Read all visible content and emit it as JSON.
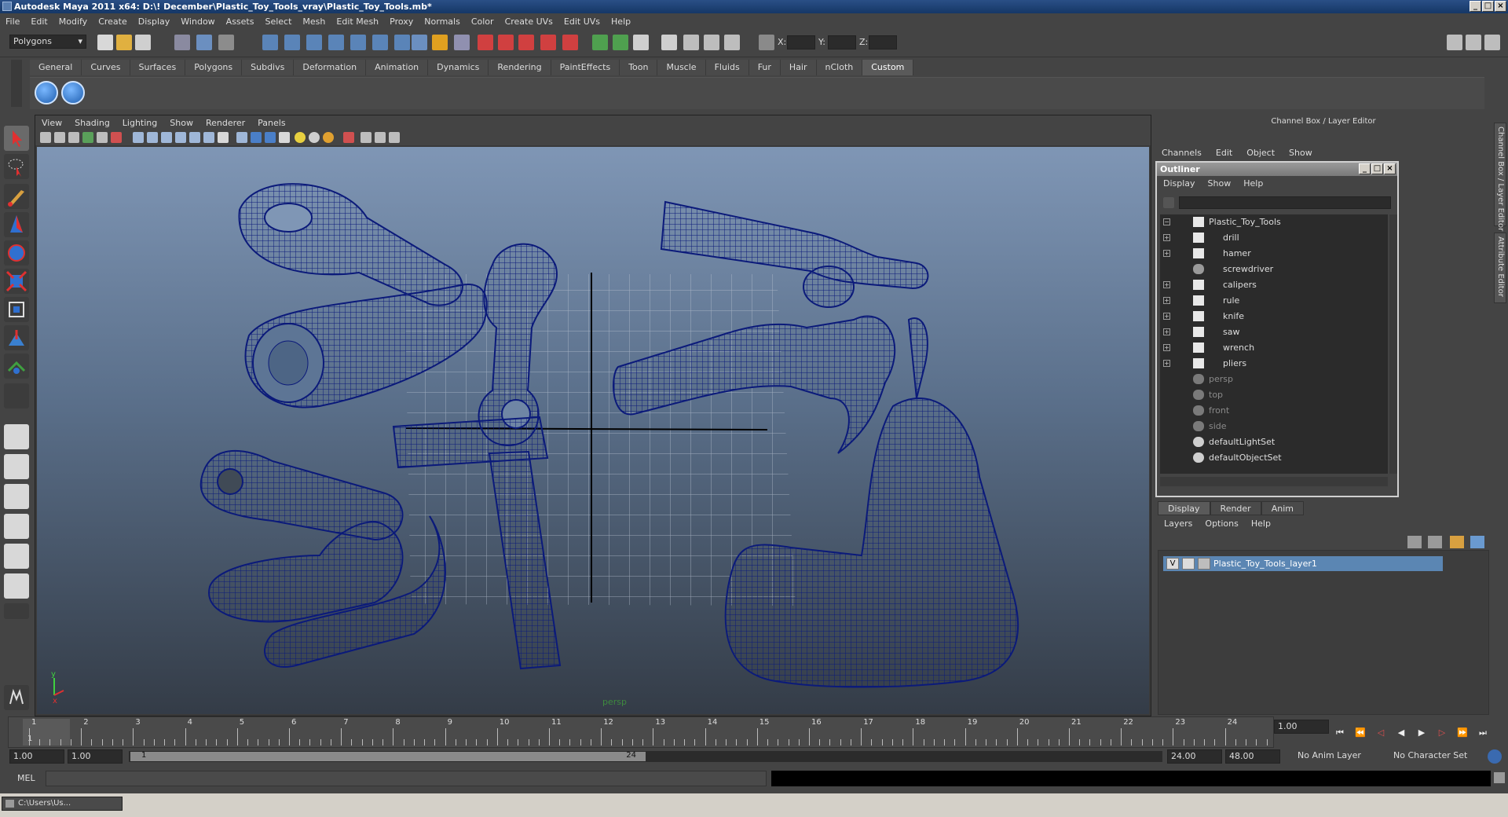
{
  "window": {
    "title": "Autodesk Maya 2011 x64: D:\\! December\\Plastic_Toy_Tools_vray\\Plastic_Toy_Tools.mb*"
  },
  "menubar": [
    "File",
    "Edit",
    "Modify",
    "Create",
    "Display",
    "Window",
    "Assets",
    "Select",
    "Mesh",
    "Edit Mesh",
    "Proxy",
    "Normals",
    "Color",
    "Create UVs",
    "Edit UVs",
    "Help"
  ],
  "statusline": {
    "menuset": "Polygons",
    "x_label": "X:",
    "y_label": "Y:",
    "z_label": "Z:"
  },
  "shelf": {
    "tabs": [
      "General",
      "Curves",
      "Surfaces",
      "Polygons",
      "Subdivs",
      "Deformation",
      "Animation",
      "Dynamics",
      "Rendering",
      "PaintEffects",
      "Toon",
      "Muscle",
      "Fluids",
      "Fur",
      "Hair",
      "nCloth",
      "Custom"
    ],
    "active_tab": "Custom"
  },
  "viewport": {
    "menu": [
      "View",
      "Shading",
      "Lighting",
      "Show",
      "Renderer",
      "Panels"
    ],
    "camera": "persp"
  },
  "channelbox": {
    "title": "Channel Box / Layer Editor",
    "menu": [
      "Channels",
      "Edit",
      "Object",
      "Show"
    ],
    "side_tabs": [
      "Channel Box / Layer Editor",
      "Attribute Editor"
    ]
  },
  "outliner": {
    "title": "Outliner",
    "menu": [
      "Display",
      "Show",
      "Help"
    ],
    "items": [
      {
        "label": "Plastic_Toy_Tools",
        "expand": "−",
        "dim": false
      },
      {
        "label": "drill",
        "expand": "+",
        "dim": false
      },
      {
        "label": "hamer",
        "expand": "+",
        "dim": false
      },
      {
        "label": "screwdriver",
        "expand": "",
        "dim": false
      },
      {
        "label": "calipers",
        "expand": "+",
        "dim": false
      },
      {
        "label": "rule",
        "expand": "+",
        "dim": false
      },
      {
        "label": "knife",
        "expand": "+",
        "dim": false
      },
      {
        "label": "saw",
        "expand": "+",
        "dim": false
      },
      {
        "label": "wrench",
        "expand": "+",
        "dim": false
      },
      {
        "label": "pliers",
        "expand": "+",
        "dim": false
      },
      {
        "label": "persp",
        "expand": "",
        "dim": true
      },
      {
        "label": "top",
        "expand": "",
        "dim": true
      },
      {
        "label": "front",
        "expand": "",
        "dim": true
      },
      {
        "label": "side",
        "expand": "",
        "dim": true
      },
      {
        "label": "defaultLightSet",
        "expand": "",
        "dim": false
      },
      {
        "label": "defaultObjectSet",
        "expand": "",
        "dim": false
      }
    ]
  },
  "layers": {
    "tabs": [
      "Display",
      "Render",
      "Anim"
    ],
    "menu": [
      "Layers",
      "Options",
      "Help"
    ],
    "visible_flag": "V",
    "layer_name": "Plastic_Toy_Tools_layer1"
  },
  "timeslider": {
    "ticks": [
      "1",
      "2",
      "3",
      "4",
      "5",
      "6",
      "7",
      "8",
      "9",
      "10",
      "11",
      "12",
      "13",
      "14",
      "15",
      "16",
      "17",
      "18",
      "19",
      "20",
      "21",
      "22",
      "23",
      "24"
    ],
    "current_frame_marker": "1",
    "current_time": "1.00"
  },
  "range": {
    "start_time": "1.00",
    "playback_start": "1.00",
    "range_start": "1",
    "range_end": "24",
    "playback_end": "24.00",
    "end_time": "48.00",
    "anim_layer": "No Anim Layer",
    "character_set": "No Character Set"
  },
  "commandline": {
    "label": "MEL"
  },
  "taskbar": {
    "label": "C:\\Users\\Us..."
  }
}
